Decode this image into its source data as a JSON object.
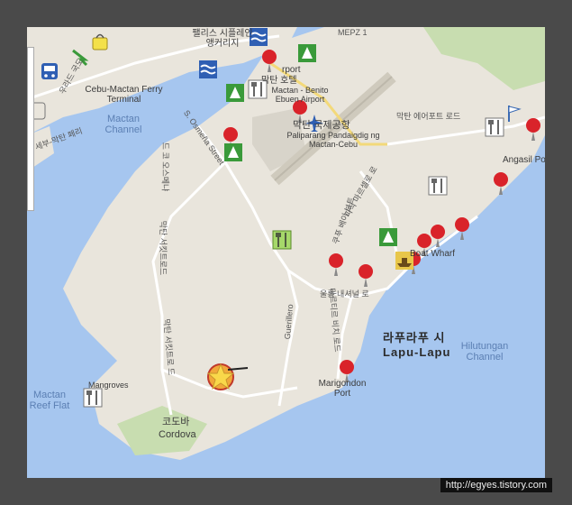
{
  "labels": {
    "palace_kr": "팰리스 시플레인 앵커리지",
    "airport_en": "Mactan - Benito Ebuen Airport",
    "airport_top": "rport",
    "hotel_kr": "막탄 호텔",
    "mepz": "MEPZ 1",
    "ferry_terminal": "Cebu-Mactan Ferry Terminal",
    "mactan_channel": "Mactan Channel",
    "cebu_ferry_kr": "세부-막탄 페리",
    "osmena": "S. Osmeña Street",
    "airport_kr": "막탄 국제공항",
    "airport_local": "Paliparang Pandaigdig ng Mactan-Cebu",
    "airport_rd_kr": "막탄 에어포트 로드",
    "angasil": "Angasil Po",
    "road_kr_1": "드 코 오스메냐",
    "road_kr_2": "막탄 서킷트로드",
    "road_kr_3": "파직 마르셀로 로",
    "road_kr_4": "쿠푸 베이 보트",
    "boat_wharf": "Boat Wharf",
    "road_kr_5": "울롱 내셔널 로",
    "guerillero": "Guerillero",
    "road_kr_6": "마르티르 비치 로드",
    "lapulapu_kr": "라푸라푸 시",
    "lapulapu_en": "Lapu-Lapu",
    "hilutungan": "Hilutungan Channel",
    "marigondon": "Marigondon Port",
    "mangroves": "Mangroves",
    "reef_flat": "Mactan Reef Flat",
    "cordova_kr": "코도바",
    "cordova_en": "Cordova",
    "road_kr_7": "막탄 서킷트로 드",
    "left_kr": "우라드 국도"
  },
  "watermark": "http://egyes.tistory.com",
  "colors": {
    "water": "#a6c6ef",
    "land": "#e9e5dc",
    "green": "#c8ddb0",
    "road": "#ffffff",
    "pin": "#d9232a"
  },
  "markers": {
    "pins": 16,
    "star_label": "current-location-star"
  }
}
